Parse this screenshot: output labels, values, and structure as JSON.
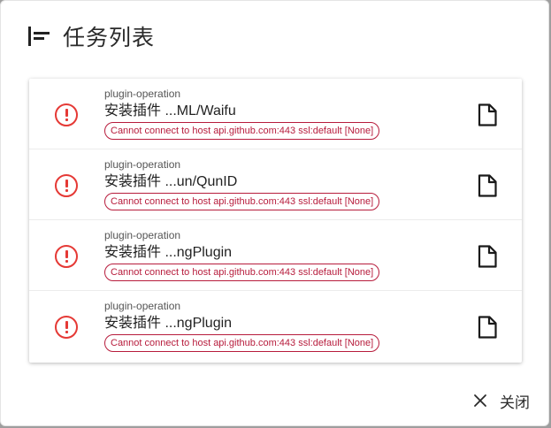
{
  "dialog": {
    "title": "任务列表",
    "close_label": "关闭"
  },
  "colors": {
    "error": "#e53935",
    "chip": "#b71c3c"
  },
  "tasks": [
    {
      "kind": "plugin-operation",
      "name": "安装插件 ...ML/Waifu",
      "error": "Cannot connect to host api.github.com:443 ssl:default [None]"
    },
    {
      "kind": "plugin-operation",
      "name": "安装插件 ...un/QunID",
      "error": "Cannot connect to host api.github.com:443 ssl:default [None]"
    },
    {
      "kind": "plugin-operation",
      "name": "安装插件 ...ngPlugin",
      "error": "Cannot connect to host api.github.com:443 ssl:default [None]"
    },
    {
      "kind": "plugin-operation",
      "name": "安装插件 ...ngPlugin",
      "error": "Cannot connect to host api.github.com:443 ssl:default [None]"
    }
  ]
}
